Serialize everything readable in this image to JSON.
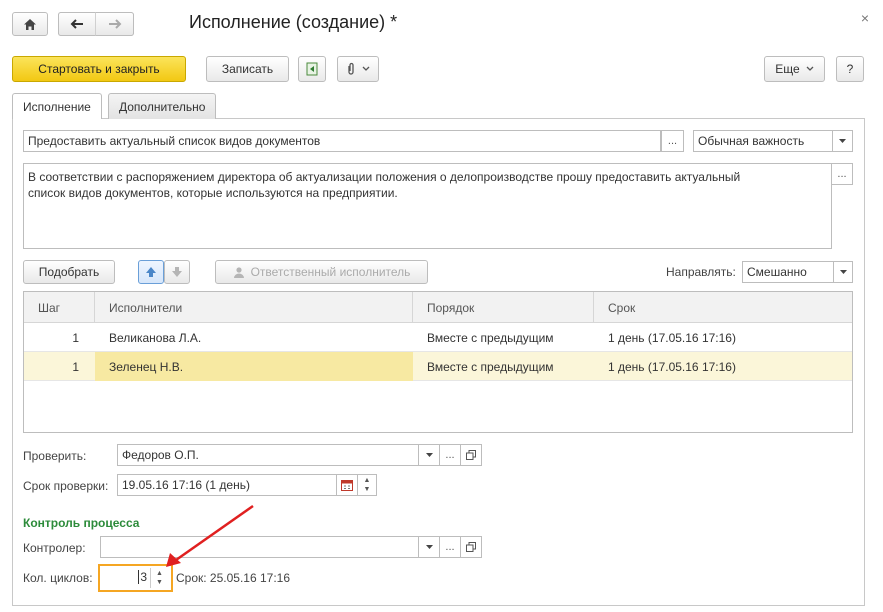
{
  "window": {
    "title": "Исполнение (создание) *",
    "close_glyph": "×"
  },
  "toolbar": {
    "start_close": "Стартовать и закрыть",
    "save": "Записать",
    "more": "Еще",
    "help": "?"
  },
  "tabs": [
    {
      "label": "Исполнение",
      "active": true
    },
    {
      "label": "Дополнительно",
      "active": false
    }
  ],
  "task": {
    "subject": "Предоставить актуальный список видов документов",
    "importance": "Обычная важность",
    "description_line1": "В соответствии с распоряжением директора об актуализации положения о делопроизводстве прошу предоставить актуальный",
    "description_line2": "список видов документов, которые используются на предприятии."
  },
  "performers_bar": {
    "pick": "Подобрать",
    "responsible": "Ответственный исполнитель",
    "direct_label": "Направлять:",
    "direct_value": "Смешанно"
  },
  "table": {
    "columns": [
      "Шаг",
      "Исполнители",
      "Порядок",
      "Срок"
    ],
    "rows": [
      {
        "step": "1",
        "performer": "Великанова Л.А.",
        "order": "Вместе с предыдущим",
        "deadline": "1 день (17.05.16 17:16)"
      },
      {
        "step": "1",
        "performer": "Зеленец Н.В.",
        "order": "Вместе с предыдущим",
        "deadline": "1 день (17.05.16 17:16)"
      }
    ]
  },
  "check": {
    "label": "Проверить:",
    "value": "Федоров О.П.",
    "deadline_label": "Срок проверки:",
    "deadline_value": "19.05.16 17:16 (1 день)"
  },
  "process_control": {
    "title": "Контроль процесса",
    "controller_label": "Контролер:",
    "controller_value": "",
    "cycles_label": "Кол. циклов:",
    "cycles_value": "3",
    "term_text": "Срок: 25.05.16 17:16"
  },
  "colors": {
    "accent_yellow": "#f2c813",
    "section_green": "#2c8b3a",
    "annotation_red": "#e02020",
    "focus_orange": "#f5a623"
  }
}
